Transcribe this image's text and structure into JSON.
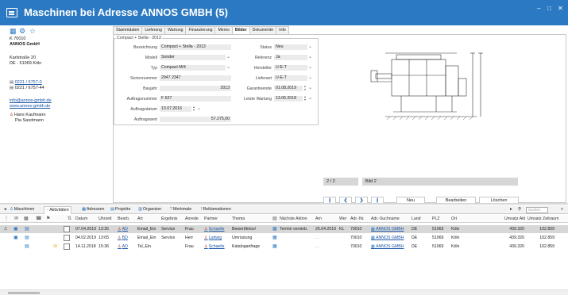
{
  "window": {
    "title": "Maschinen bei Adresse ANNOS GMBH (5)",
    "controls": [
      "–",
      "□",
      "✕"
    ]
  },
  "left": {
    "kundennr": "K 70010",
    "name": "ANNOS GmbH",
    "street": "Karlstraße 20",
    "city": "DE - 51069 Köln",
    "phone": "0221 / 6757-0",
    "fax": "0221 / 6757-44",
    "email": "info@annos-gmbh.de",
    "web": "www.annos-gmbh.de",
    "contacts": [
      "Hans Kaufmann",
      "Pia Sandmann"
    ]
  },
  "tabs": [
    "Stammdaten",
    "Lieferung",
    "Wartung",
    "Finanzierung",
    "Memo",
    "Bilder",
    "Dokumente",
    "Info"
  ],
  "active_tab": "Bilder",
  "form": {
    "legend": "Compact + Stella - 2013",
    "left_fields": [
      {
        "label": "Bezeichnung",
        "value": "Compact + Stella - 2013"
      },
      {
        "label": "Modell",
        "value": "Sonder"
      },
      {
        "label": "Typ",
        "value": "Compact M/4"
      },
      {
        "label": "Seriennummer",
        "value": "2947 2347"
      },
      {
        "label": "Baujahr",
        "value": "2013"
      },
      {
        "label": "Auftragsnummer",
        "value": "F 627"
      },
      {
        "label": "Auftragsdatum",
        "value": "13.07.2016"
      },
      {
        "label": "Auftragswert",
        "value": "57.275,00"
      }
    ],
    "right_fields": [
      {
        "label": "Status",
        "value": "Neu"
      },
      {
        "label": "Referenz",
        "value": "Ja"
      },
      {
        "label": "Hersteller",
        "value": "U-E-T"
      },
      {
        "label": "Lieferant",
        "value": "U-E-T"
      },
      {
        "label": "Garantieende",
        "value": "01.08.2019"
      },
      {
        "label": "Letzte Wartung",
        "value": "13.06.2018"
      }
    ]
  },
  "image": {
    "counter": "2 / 2",
    "name": "Bild 2",
    "buttons": {
      "neu": "Neu",
      "bearbeiten": "Bearbeiten",
      "loeschen": "Löschen"
    }
  },
  "bottom_tabs": [
    "Maschinen",
    "Aktivitäten",
    "Adressen",
    "Projekte",
    "Organizer",
    "Merkmale",
    "Reklamationen"
  ],
  "active_bottom_tab": "Aktivitäten",
  "search_placeholder": "Suchen",
  "table": {
    "headers": [
      "Datum",
      "Uhrzeit",
      "Bearb.",
      "Art",
      "Ergebnis",
      "Anrede",
      "Partner",
      "Thema",
      "Nächste Aktion",
      "Am",
      "Wer",
      "Adr.-Nr.",
      "Adr.-Suchname",
      "Land",
      "PLZ",
      "Ort",
      "Umsatz Akt",
      "Umsatz Zeitraum"
    ],
    "rows": [
      [
        "07.04.2019",
        "13:35",
        "AD",
        "Email_Ein",
        "Service",
        "Frau",
        "Schaelle",
        "Bewerbfotos!",
        "Termin vereinb.",
        "26.04.2019",
        "KL",
        "70010",
        "ANNOS GMBH",
        "DE",
        "51069",
        "Köln",
        "439.320",
        "102.859"
      ],
      [
        "04.02.2019",
        "13:05",
        "BD",
        "Email_Ein",
        "Service",
        "Herr",
        "Ludwig",
        "Umrüstung",
        "",
        ". .",
        "",
        "70010",
        "ANNOS GMBH",
        "DE",
        "51069",
        "Köln",
        "439.320",
        "102.859"
      ],
      [
        "14.11.2018",
        "15:36",
        "AD",
        "Tel_Ein",
        "",
        "Frau",
        "Schaelle",
        "Kataloganfrage",
        "",
        ". .",
        "",
        "70010",
        "ANNOS GMBH",
        "DE",
        "51069",
        "Köln",
        "439.320",
        "102.859"
      ]
    ]
  }
}
